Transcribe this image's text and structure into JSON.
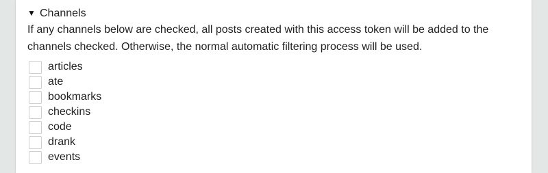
{
  "section": {
    "title": "Channels",
    "toggle_icon": "triangle-down-icon",
    "description": "If any channels below are checked, all posts created with this access token will be added to the channels checked. Otherwise, the normal automatic filtering process will be used."
  },
  "channels": [
    {
      "label": "articles",
      "checked": false
    },
    {
      "label": "ate",
      "checked": false
    },
    {
      "label": "bookmarks",
      "checked": false
    },
    {
      "label": "checkins",
      "checked": false
    },
    {
      "label": "code",
      "checked": false
    },
    {
      "label": "drank",
      "checked": false
    },
    {
      "label": "events",
      "checked": false
    }
  ]
}
